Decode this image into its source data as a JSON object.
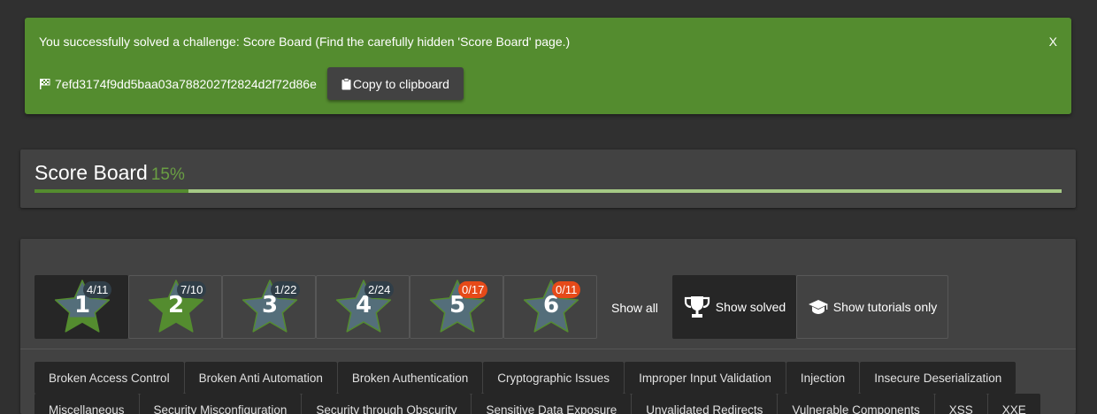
{
  "notification": {
    "message": "You successfully solved a challenge: Score Board (Find the carefully hidden 'Score Board' page.)",
    "close_label": "X",
    "flag_icon": "flag-icon",
    "flag_code": "7efd3174f9dd5baa03a7882027f2824d2f72d86e",
    "copy_label": "Copy to clipboard",
    "copy_icon": "clipboard-icon"
  },
  "score_board": {
    "title": "Score Board",
    "percent_text": "15%",
    "progress": 0.15,
    "color_solved": "#548c2f",
    "color_track": "#a5c985"
  },
  "difficulty_filters": [
    {
      "level": "1",
      "badge": "4/11",
      "progress": 0.36,
      "badge_color": "#303e48",
      "active": true
    },
    {
      "level": "2",
      "badge": "7/10",
      "progress": 0.7,
      "badge_color": "#303e48",
      "active": false
    },
    {
      "level": "3",
      "badge": "1/22",
      "progress": 0.05,
      "badge_color": "#303e48",
      "active": false
    },
    {
      "level": "4",
      "badge": "2/24",
      "progress": 0.08,
      "badge_color": "#303e48",
      "active": false
    },
    {
      "level": "5",
      "badge": "0/17",
      "progress": 0.0,
      "badge_color": "#e64a19",
      "active": false
    },
    {
      "level": "6",
      "badge": "0/11",
      "progress": 0.0,
      "badge_color": "#e64a19",
      "active": false
    }
  ],
  "toggles": {
    "show_all": "Show all",
    "show_solved": "Show solved",
    "show_solved_icon": "trophy-icon",
    "show_tutorials": "Show tutorials only",
    "show_tutorials_icon": "graduation-cap-icon"
  },
  "categories_row1": [
    "Broken Access Control",
    "Broken Anti Automation",
    "Broken Authentication",
    "Cryptographic Issues",
    "Improper Input Validation",
    "Injection",
    "Insecure Deserialization"
  ],
  "categories_row2": [
    "Miscellaneous",
    "Security Misconfiguration",
    "Security through Obscurity",
    "Sensitive Data Exposure",
    "Unvalidated Redirects",
    "Vulnerable Components",
    "XSS",
    "XXE"
  ]
}
